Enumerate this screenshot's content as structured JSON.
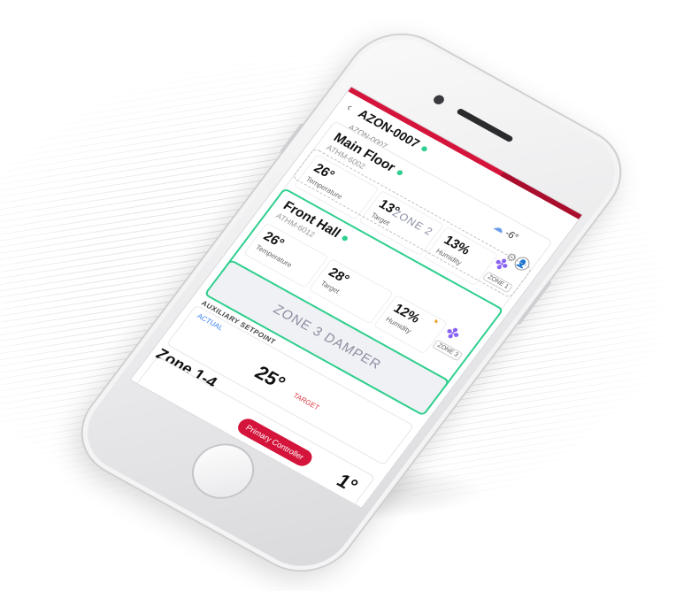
{
  "device": {
    "name": "AZON-0007",
    "code": "AZON-0007"
  },
  "main_zone": {
    "name": "Main Floor",
    "code": "ATHM-6002",
    "weather_temp": "-6°",
    "temperature": "26°",
    "temperature_label": "Temperature",
    "target": "13°",
    "target_label": "Target",
    "humidity": "13%",
    "humidity_label": "Humidity",
    "zone_tag": "ZONE 1"
  },
  "zone2": {
    "label": "ZONE 2"
  },
  "front_hall": {
    "name": "Front Hall",
    "code": "ATHM-6012",
    "temperature": "26°",
    "temperature_label": "Temperature",
    "target": "28°",
    "target_label": "Target",
    "humidity": "12%",
    "humidity_label": "Humidity",
    "zone_tag": "ZONE 3"
  },
  "damper": {
    "label": "ZONE 3 DAMPER"
  },
  "auxiliary": {
    "label": "AUXILIARY SETPOINT",
    "actual_label": "ACTUAL",
    "actual_value": "25°",
    "target_label": "TARGET"
  },
  "zones_group": {
    "label": "Zone 1-4",
    "primary_button": "Primary Controller",
    "value": "1°"
  },
  "icons": {
    "back": "chevron-left-icon",
    "weather": "cloud-sun-icon",
    "settings": "gear-icon",
    "user": "user-icon",
    "fan": "fan-icon",
    "timer": "timer-icon"
  },
  "colors": {
    "accent": "#d4143a",
    "online": "#2ecf8e",
    "fan": "#8a63f5",
    "timer": "#f0a01e",
    "actual": "#3b82f6",
    "target": "#e03545"
  }
}
